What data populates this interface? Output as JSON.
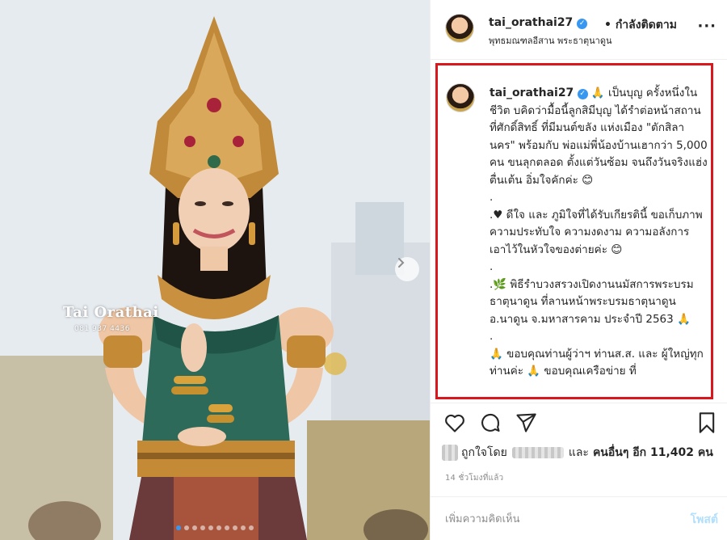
{
  "photo": {
    "watermark_title": "Tai Orathai",
    "watermark_phone": "081 937 4436",
    "carousel_dot_count": 10,
    "carousel_active_index": 0,
    "next_icon": "chevron-right-icon"
  },
  "header": {
    "username": "tai_orathai27",
    "verified_icon": "verified-badge-icon",
    "separator": "•",
    "follow_status": "กำลังติดตาม",
    "location": "พุทธมณฑลอีสาน พระธาตุนาดูน",
    "more_icon": "more-options-icon"
  },
  "caption": {
    "username": "tai_orathai27",
    "text": "🙏 เป็นบุญ ครั้งหนึ่งในชีวิต บคิดว่ามื้อนี้ลูกสิมีบุญ ได้รำต่อหน้าสถานที่ศักดิ์สิทธิ์ ที่มีมนต์ขลัง แห่งเมือง \"ตักสิลานคร\" พร้อมกับ พ่อแม่พี่น้องบ้านเฮากว่า 5,000 คน ขนลุกตลอด ตั้งแต่วันซ้อม จนถึงวันจริงแฮ่งตื่นเต้น อิ่มใจคักค่ะ 😊\n.\n.♥ ดีใจ และ ภูมิใจที่ได้รับเกียรตินี้ ขอเก็บภาพความประทับใจ ความงดงาม ความอลังการ เอาไว้ในหัวใจของต่ายค่ะ 😊\n.\n.🌿 พิธีรำบวงสรวงเปิดงานนมัสการพระบรมธาตุนาดูน ที่ลานหน้าพระบรมธาตุนาดูน อ.นาดูน จ.มหาสารคาม ประจำปี 2563 🙏\n.\n🙏 ขอบคุณท่านผู้ว่าฯ ท่านส.ส. และ ผู้ใหญ่ทุกท่านค่ะ 🙏 ขอบคุณเครือข่าย ที่"
  },
  "actions": {
    "like_icon": "heart-icon",
    "comment_icon": "comment-icon",
    "share_icon": "share-icon",
    "save_icon": "bookmark-icon"
  },
  "likes": {
    "prefix": "ถูกใจโดย",
    "and": "และ",
    "others_label": "คนอื่นๆ อีก 11,402 คน"
  },
  "timestamp": "14 ชั่วโมงที่แล้ว",
  "comment": {
    "placeholder": "เพิ่มความคิดเห็น",
    "post_label": "โพสต์"
  },
  "colors": {
    "highlight_border": "#d9171d",
    "verified": "#3897f0",
    "post_button_disabled": "#b2dffc"
  }
}
